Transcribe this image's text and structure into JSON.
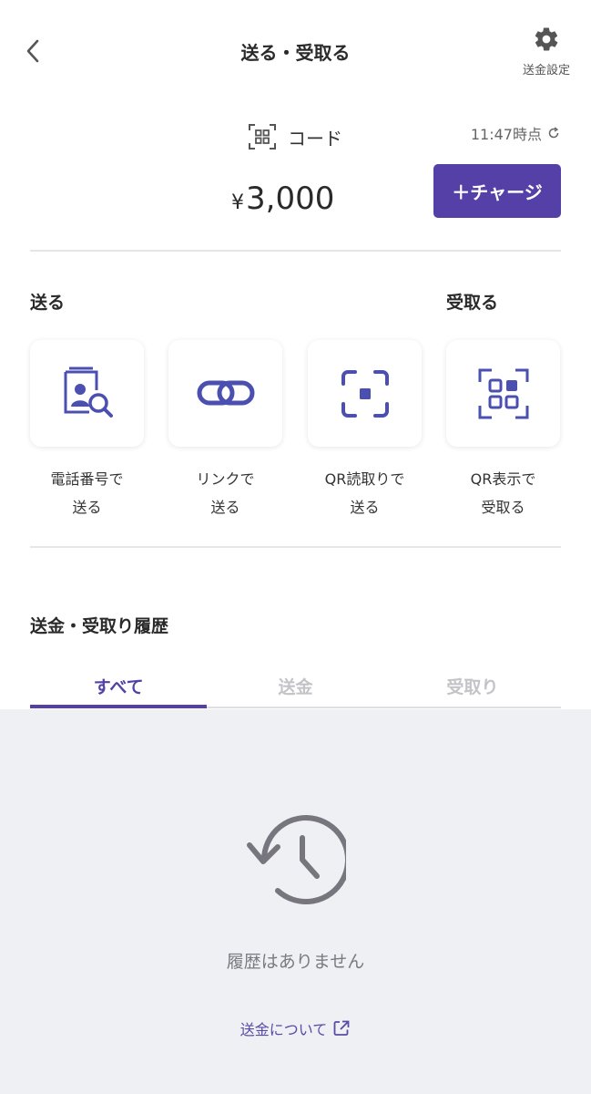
{
  "header": {
    "title": "送る・受取る",
    "settings_label": "送金設定",
    "back_icon": "chevron-left-icon",
    "settings_icon": "gear-icon"
  },
  "balance": {
    "code_label": "コード",
    "timestamp": "11:47時点",
    "currency": "¥",
    "amount": "3,000",
    "charge_button": "＋チャージ"
  },
  "send_section": {
    "title": "送る"
  },
  "receive_section": {
    "title": "受取る"
  },
  "actions": [
    {
      "line1": "電話番号で",
      "line2": "送る",
      "icon": "phonebook-search-icon"
    },
    {
      "line1": "リンクで",
      "line2": "送る",
      "icon": "link-icon"
    },
    {
      "line1": "QR読取りで",
      "line2": "送る",
      "icon": "qr-scan-icon"
    },
    {
      "line1": "QR表示で",
      "line2": "受取る",
      "icon": "qr-display-icon"
    }
  ],
  "history": {
    "title": "送金・受取り履歴",
    "tabs": [
      "すべて",
      "送金",
      "受取り"
    ],
    "active_tab": "すべて",
    "empty_text": "履歴はありません",
    "about_link": "送金について"
  },
  "colors": {
    "accent": "#5440a6",
    "icon_blue": "#4a4fb0",
    "empty_bg": "#eef0f3"
  }
}
